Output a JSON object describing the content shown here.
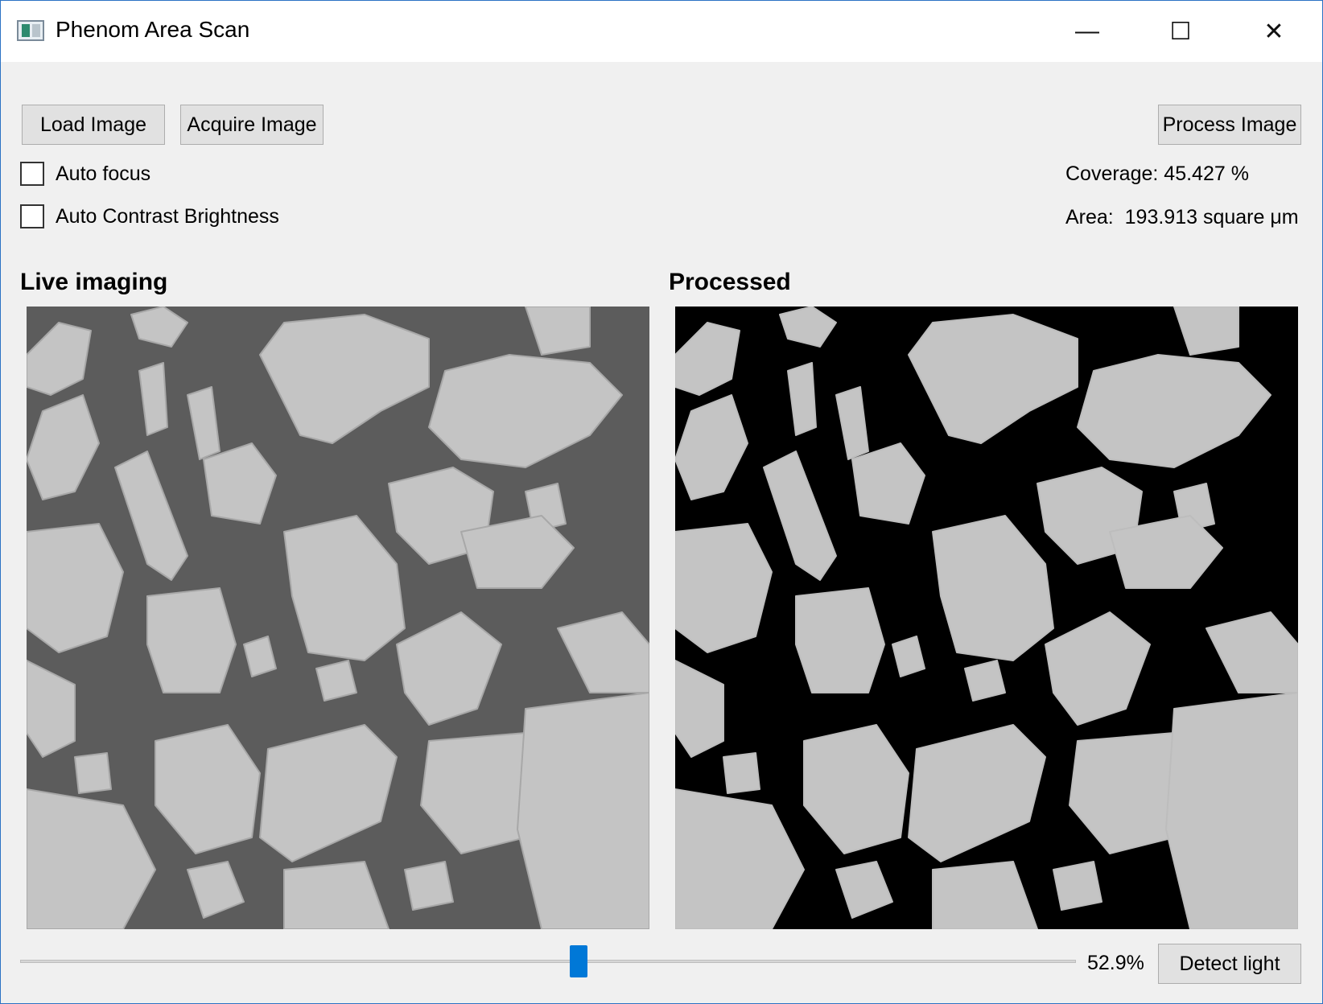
{
  "window": {
    "title": "Phenom Area Scan",
    "controls": {
      "minimize": "—",
      "maximize": "☐",
      "close": "✕"
    }
  },
  "toolbar": {
    "load_label": "Load Image",
    "acquire_label": "Acquire Image",
    "process_label": "Process Image"
  },
  "options": {
    "auto_focus": {
      "label": "Auto focus",
      "checked": false
    },
    "auto_contrast": {
      "label": "Auto Contrast Brightness",
      "checked": false
    }
  },
  "results": {
    "coverage": "Coverage: 45.427 %",
    "area": "Area:  193.913 square μm"
  },
  "panels": {
    "live_title": "Live imaging",
    "processed_title": "Processed"
  },
  "threshold": {
    "value_label": "52.9%",
    "fraction": 0.529,
    "detect_label": "Detect light"
  },
  "colors": {
    "accent": "#0078d7",
    "live_background": "#5c5c5c",
    "processed_background": "#000000",
    "particle": "#c4c4c4"
  }
}
